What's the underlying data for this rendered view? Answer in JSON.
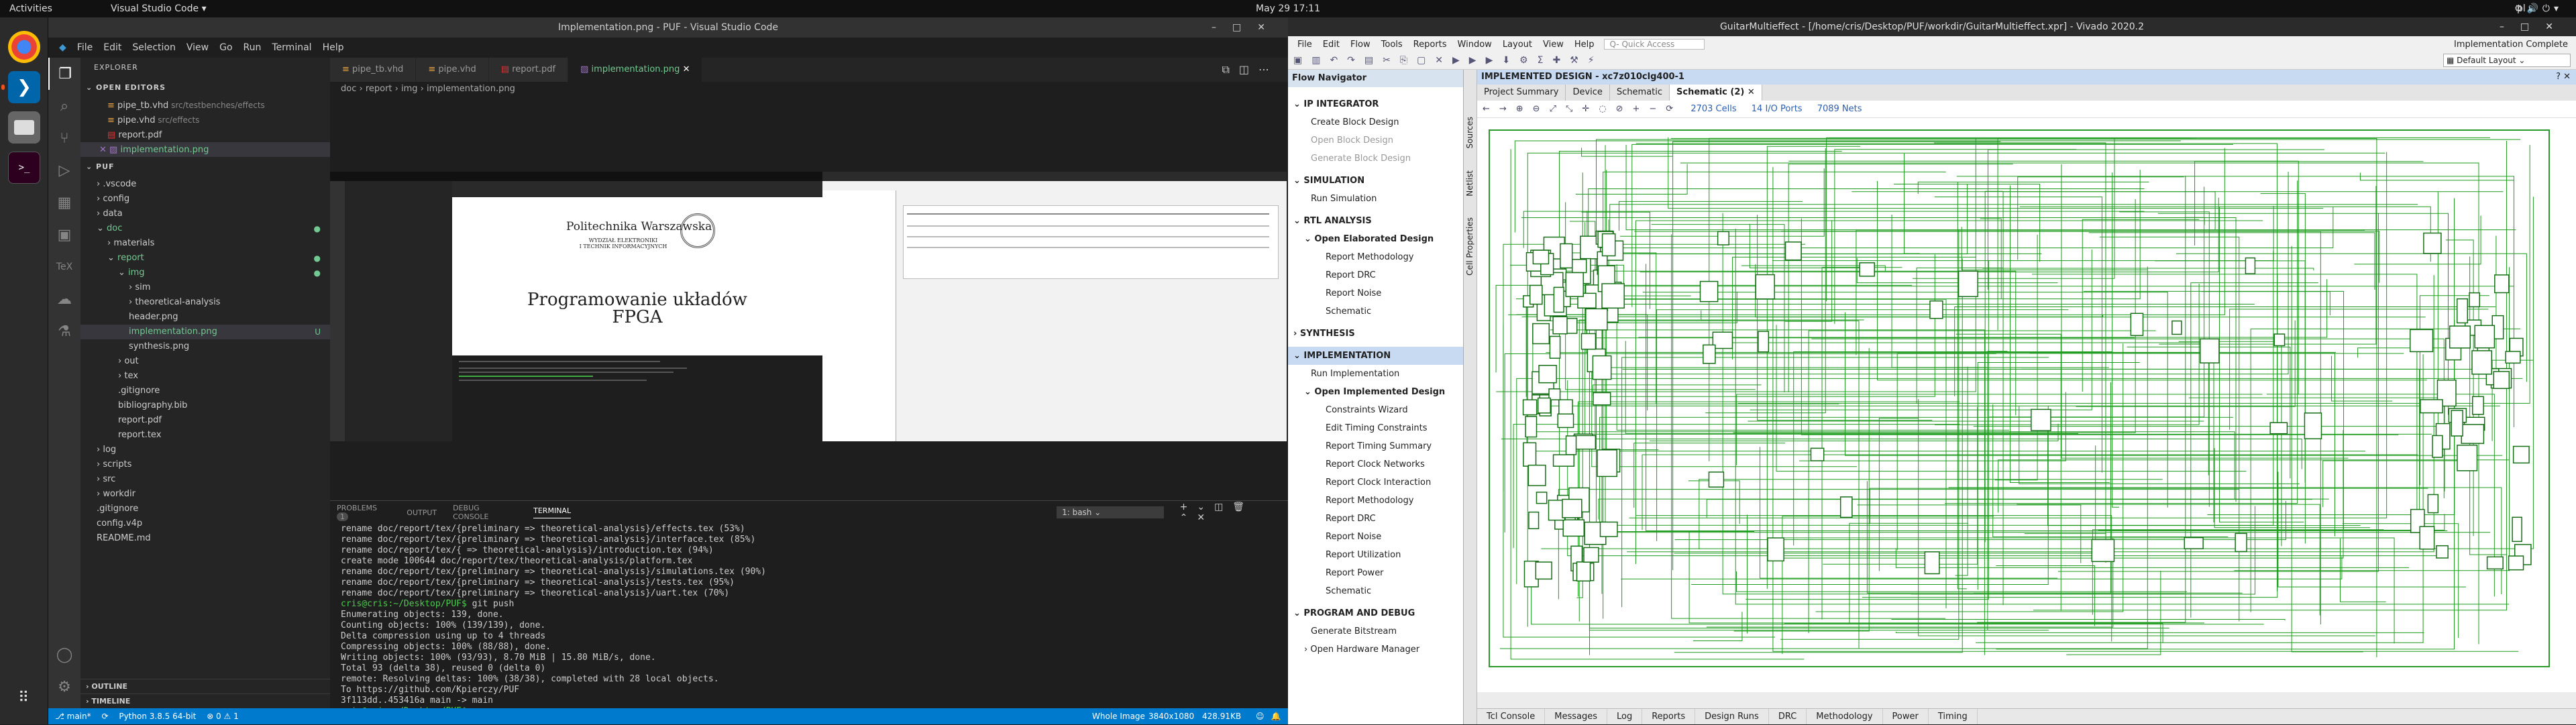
{
  "topbar": {
    "activities": "Activities",
    "app": "Visual Studio Code ▾",
    "clock": "May 29  17:11",
    "lang": "pl ▾"
  },
  "vscode": {
    "title": "Implementation.png - PUF - Visual Studio Code",
    "menu": [
      "File",
      "Edit",
      "Selection",
      "View",
      "Go",
      "Run",
      "Terminal",
      "Help"
    ],
    "explorer": "EXPLORER",
    "open_editors": "OPEN EDITORS",
    "open_files": [
      {
        "name": "pipe_tb.vhd",
        "hint": "src/testbenches/effects"
      },
      {
        "name": "pipe.vhd",
        "hint": "src/effects"
      },
      {
        "name": "report.pdf",
        "hint": ""
      },
      {
        "name": "implementation.png",
        "hint": ""
      }
    ],
    "root": "PUF",
    "tree": [
      {
        "n": ".vscode",
        "d": 1,
        "t": "folder"
      },
      {
        "n": "config",
        "d": 1,
        "t": "folder"
      },
      {
        "n": "data",
        "d": 1,
        "t": "folder"
      },
      {
        "n": "doc",
        "d": 1,
        "t": "folder-open",
        "b": "●"
      },
      {
        "n": "materials",
        "d": 2,
        "t": "folder"
      },
      {
        "n": "report",
        "d": 2,
        "t": "folder-open",
        "b": "●"
      },
      {
        "n": "img",
        "d": 3,
        "t": "folder-open",
        "b": "●"
      },
      {
        "n": "sim",
        "d": 4,
        "t": "folder"
      },
      {
        "n": "theoretical-analysis",
        "d": 4,
        "t": "folder"
      },
      {
        "n": "header.png",
        "d": 4,
        "t": "file"
      },
      {
        "n": "implementation.png",
        "d": 4,
        "t": "file",
        "b": "U",
        "sel": true
      },
      {
        "n": "synthesis.png",
        "d": 4,
        "t": "file"
      },
      {
        "n": "out",
        "d": 3,
        "t": "folder"
      },
      {
        "n": "tex",
        "d": 3,
        "t": "folder"
      },
      {
        "n": ".gitignore",
        "d": 3,
        "t": "file"
      },
      {
        "n": "bibliography.bib",
        "d": 3,
        "t": "file"
      },
      {
        "n": "report.pdf",
        "d": 3,
        "t": "file"
      },
      {
        "n": "report.tex",
        "d": 3,
        "t": "file"
      },
      {
        "n": "log",
        "d": 1,
        "t": "folder"
      },
      {
        "n": "scripts",
        "d": 1,
        "t": "folder"
      },
      {
        "n": "src",
        "d": 1,
        "t": "folder"
      },
      {
        "n": "workdir",
        "d": 1,
        "t": "folder"
      },
      {
        "n": ".gitignore",
        "d": 1,
        "t": "file"
      },
      {
        "n": "config.v4p",
        "d": 1,
        "t": "file"
      },
      {
        "n": "README.md",
        "d": 1,
        "t": "file"
      }
    ],
    "outline": "OUTLINE",
    "timeline": "TIMELINE",
    "tabs": [
      "pipe_tb.vhd",
      "pipe.vhd",
      "report.pdf",
      "implementation.png"
    ],
    "breadcrumbs": "doc › report › img › implementation.png",
    "preview_title_pl": "Politechnika Warszawska",
    "preview_sub": "WYDZIAŁ ELEKTRONIKI\nI TECHNIK INFORMACYJNYCH",
    "preview_heading": "Programowanie układów\nFPGA",
    "panel_tabs": [
      "PROBLEMS",
      "OUTPUT",
      "DEBUG CONSOLE",
      "TERMINAL"
    ],
    "problems_count": "1",
    "terminal_select": "1: bash",
    "terminal": [
      " rename doc/report/tex/{preliminary => theoretical-analysis}/effects.tex (53%)",
      " rename doc/report/tex/{preliminary => theoretical-analysis}/interface.tex (85%)",
      " rename doc/report/tex/{ => theoretical-analysis}/introduction.tex (94%)",
      " create mode 100644 doc/report/tex/theoretical-analysis/platform.tex",
      " rename doc/report/tex/{preliminary => theoretical-analysis}/simulations.tex (90%)",
      " rename doc/report/tex/{preliminary => theoretical-analysis}/tests.tex (95%)",
      " rename doc/report/tex/{preliminary => theoretical-analysis}/uart.tex (70%)",
      "__PROMPT__ git push",
      "Enumerating objects: 139, done.",
      "Counting objects: 100% (139/139), done.",
      "Delta compression using up to 4 threads",
      "Compressing objects: 100% (88/88), done.",
      "Writing objects: 100% (93/93), 8.70 MiB | 15.80 MiB/s, done.",
      "Total 93 (delta 38), reused 0 (delta 0)",
      "remote: Resolving deltas: 100% (38/38), completed with 28 local objects.",
      "To https://github.com/Kpierczy/PUF",
      "   3f113dd..453416a  main -> main",
      "__PROMPT__ "
    ],
    "prompt": "cris@cris:~/Desktop/PUF$",
    "status_left": [
      "⎇ main*",
      "⟳",
      "Python 3.8.5 64-bit",
      "⊗ 0 ⚠ 1"
    ],
    "status_right": [
      "Whole Image",
      "3840x1080",
      "428.91KB"
    ]
  },
  "vivado": {
    "title": "GuitarMultieffect - [/home/cris/Desktop/PUF/workdir/GuitarMultieffect.xpr] - Vivado 2020.2",
    "menu": [
      "File",
      "Edit",
      "Flow",
      "Tools",
      "Reports",
      "Window",
      "Layout",
      "View",
      "Help"
    ],
    "quick_access": "Q- Quick Access",
    "impl_complete": "Implementation Complete",
    "layout": "Default Layout",
    "flow_nav": "Flow Navigator",
    "flow": [
      {
        "t": "IP INTEGRATOR",
        "k": "sec"
      },
      {
        "t": "Create Block Design",
        "k": "item"
      },
      {
        "t": "Open Block Design",
        "k": "dis"
      },
      {
        "t": "Generate Block Design",
        "k": "dis"
      },
      {
        "t": "SIMULATION",
        "k": "sec"
      },
      {
        "t": "Run Simulation",
        "k": "item"
      },
      {
        "t": "RTL ANALYSIS",
        "k": "sec"
      },
      {
        "t": "Open Elaborated Design",
        "k": "sub"
      },
      {
        "t": "Report Methodology",
        "k": "item2"
      },
      {
        "t": "Report DRC",
        "k": "item2"
      },
      {
        "t": "Report Noise",
        "k": "item2"
      },
      {
        "t": "Schematic",
        "k": "item2"
      },
      {
        "t": "SYNTHESIS",
        "k": "secc"
      },
      {
        "t": "IMPLEMENTATION",
        "k": "sechl"
      },
      {
        "t": "Run Implementation",
        "k": "item"
      },
      {
        "t": "Open Implemented Design",
        "k": "sub"
      },
      {
        "t": "Constraints Wizard",
        "k": "item2"
      },
      {
        "t": "Edit Timing Constraints",
        "k": "item2"
      },
      {
        "t": "Report Timing Summary",
        "k": "item2"
      },
      {
        "t": "Report Clock Networks",
        "k": "item2"
      },
      {
        "t": "Report Clock Interaction",
        "k": "item2"
      },
      {
        "t": "Report Methodology",
        "k": "item2"
      },
      {
        "t": "Report DRC",
        "k": "item2"
      },
      {
        "t": "Report Noise",
        "k": "item2"
      },
      {
        "t": "Report Utilization",
        "k": "item2"
      },
      {
        "t": "Report Power",
        "k": "item2"
      },
      {
        "t": "Schematic",
        "k": "item2"
      },
      {
        "t": "PROGRAM AND DEBUG",
        "k": "sec"
      },
      {
        "t": "Generate Bitstream",
        "k": "item"
      },
      {
        "t": "Open Hardware Manager",
        "k": "subc"
      }
    ],
    "impl_header": "IMPLEMENTED DESIGN - xc7z010clg400-1",
    "side_tabs": [
      "Sources",
      "Netlist",
      "Cell Properties"
    ],
    "impl_tabs": [
      "Project Summary",
      "Device",
      "Schematic",
      "Schematic (2)"
    ],
    "stats": [
      "2703 Cells",
      "14 I/O Ports",
      "7089 Nets"
    ],
    "bottom_tabs": [
      "Tcl Console",
      "Messages",
      "Log",
      "Reports",
      "Design Runs",
      "DRC",
      "Methodology",
      "Power",
      "Timing"
    ]
  }
}
